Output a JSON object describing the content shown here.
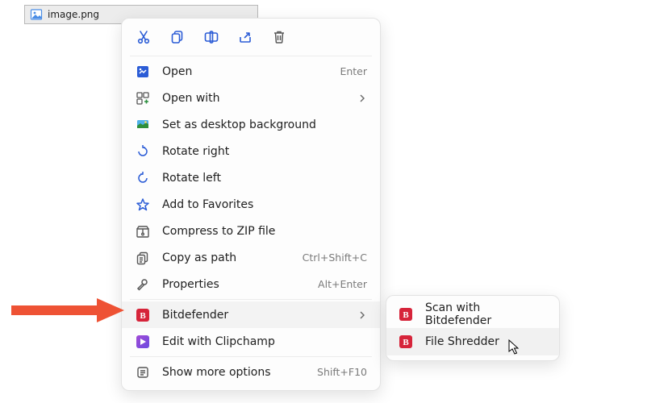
{
  "file": {
    "name": "image.png"
  },
  "toolbar": {
    "cut": {
      "name": "cut-icon"
    },
    "copy": {
      "name": "copy-icon"
    },
    "rename": {
      "name": "rename-icon"
    },
    "share": {
      "name": "share-icon"
    },
    "delete": {
      "name": "delete-icon"
    }
  },
  "menu": {
    "open": {
      "label": "Open",
      "shortcut": "Enter"
    },
    "open_with": {
      "label": "Open with"
    },
    "set_bg": {
      "label": "Set as desktop background"
    },
    "rotate_r": {
      "label": "Rotate right"
    },
    "rotate_l": {
      "label": "Rotate left"
    },
    "favorites": {
      "label": "Add to Favorites"
    },
    "compress": {
      "label": "Compress to ZIP file"
    },
    "copy_path": {
      "label": "Copy as path",
      "shortcut": "Ctrl+Shift+C"
    },
    "properties": {
      "label": "Properties",
      "shortcut": "Alt+Enter"
    },
    "bitdefender": {
      "label": "Bitdefender"
    },
    "clipchamp": {
      "label": "Edit with Clipchamp"
    },
    "more": {
      "label": "Show more options",
      "shortcut": "Shift+F10"
    }
  },
  "submenu": {
    "scan": {
      "label": "Scan with Bitdefender"
    },
    "shred": {
      "label": "File Shredder"
    }
  },
  "colors": {
    "accent_blue": "#2b5cd6",
    "bitdefender_red": "#d6243a",
    "arrow_red": "#ee5234"
  }
}
